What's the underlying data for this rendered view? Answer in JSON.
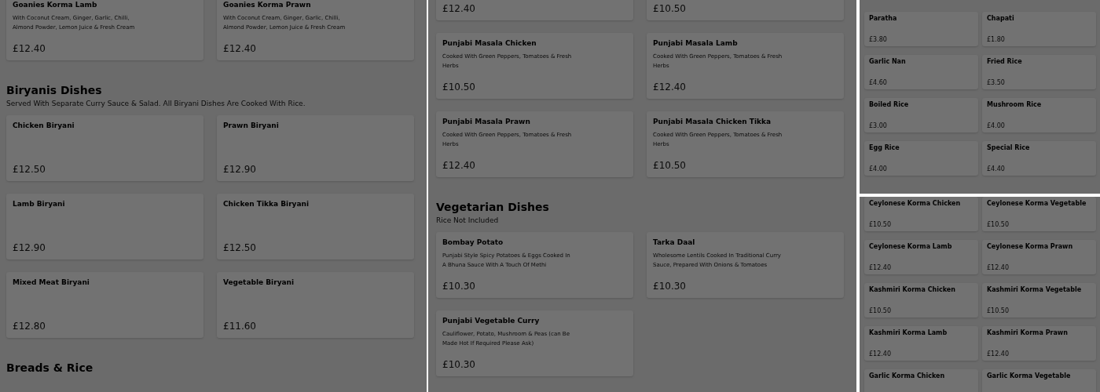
{
  "panels": [
    {
      "kind": "full",
      "sections": [
        {
          "items": [
            {
              "name": "Goanies Korma Lamb",
              "description": "With Coconut Cream, Ginger, Garlic, Chilli, Almond Powder, Lemon Juice & Fresh Cream",
              "price": "£12.40"
            },
            {
              "name": "Goanies Korma Prawn",
              "description": "With Coconut Cream, Ginger, Garlic, Chilli, Almond Powder, Lemon Juice & Fresh Cream",
              "price": "£12.40"
            }
          ]
        },
        {
          "heading": "Biryanis Dishes",
          "subtitle": "Served With Separate Curry Sauce & Salad. All Biryani Dishes Are Cooked With Rice.",
          "items": [
            {
              "name": "Chicken Biryani",
              "price": "£12.50"
            },
            {
              "name": "Prawn Biryani",
              "price": "£12.90"
            },
            {
              "name": "Lamb Biryani",
              "price": "£12.90"
            },
            {
              "name": "Chicken Tikka Biryani",
              "price": "£12.50"
            },
            {
              "name": "Mixed Meat Biryani",
              "price": "£12.80"
            },
            {
              "name": "Vegetable Biryani",
              "price": "£11.60"
            }
          ]
        },
        {
          "heading": "Breads & Rice"
        }
      ]
    },
    {
      "kind": "full",
      "sections": [
        {
          "items": [
            {
              "price": "£12.40"
            },
            {
              "price": "£10.50"
            },
            {
              "name": "Punjabi Masala Chicken",
              "description": "Cooked With Green Peppers, Tomatoes & Fresh Herbs",
              "price": "£10.50"
            },
            {
              "name": "Punjabi Masala Lamb",
              "description": "Cooked With Green Peppers, Tomatoes & Fresh Herbs",
              "price": "£12.40"
            },
            {
              "name": "Punjabi Masala Prawn",
              "description": "Cooked With Green Peppers, Tomatoes & Fresh Herbs",
              "price": "£12.40"
            },
            {
              "name": "Punjabi Masala Chicken Tikka",
              "description": "Cooked With Green Peppers, Tomatoes & Fresh Herbs",
              "price": "£10.50"
            }
          ]
        },
        {
          "heading": "Vegetarian Dishes",
          "subtitle": "Rice Not Included",
          "items": [
            {
              "name": "Bombay Potato",
              "description": "Punjabi Style Spicy Potatoes & Eggs Cooked In A Bhuna Sauce With A Touch Of Methi",
              "price": "£10.30"
            },
            {
              "name": "Tarka Daal",
              "description": "Wholesome Lentils Cooked In Traditional Curry Sauce, Prepared With Onions & Tomatoes",
              "price": "£10.30"
            },
            {
              "name": "Punjabi Vegetable Curry",
              "description": "Cauliflower, Potato, Mushroom & Peas (can Be Made Hot If Required Please Ask)",
              "price": "£10.30"
            }
          ]
        }
      ]
    },
    {
      "kind": "compact",
      "sections": [
        {
          "items": [
            {
              "name": "Paratha",
              "price": "£3.80"
            },
            {
              "name": "Chapati",
              "price": "£1.80"
            },
            {
              "name": "Garlic Nan",
              "price": "£4.60"
            },
            {
              "name": "Fried Rice",
              "price": "£3.50"
            },
            {
              "name": "Boiled Rice",
              "price": "£3.00"
            },
            {
              "name": "Mushroom Rice",
              "price": "£4.00"
            },
            {
              "name": "Egg Rice",
              "price": "£4.00"
            },
            {
              "name": "Special Rice",
              "price": "£4.40"
            }
          ]
        }
      ]
    },
    {
      "kind": "compact",
      "sections": [
        {
          "items": [
            {
              "name": "Ceylonese Korma Chicken",
              "price": "£10.50"
            },
            {
              "name": "Ceylonese Korma Vegetable",
              "price": "£10.50"
            },
            {
              "name": "Ceylonese Korma Lamb",
              "price": "£12.40"
            },
            {
              "name": "Ceylonese Korma Prawn",
              "price": "£12.40"
            },
            {
              "name": "Kashmiri Korma Chicken",
              "price": "£10.50"
            },
            {
              "name": "Kashmiri Korma Vegetable",
              "price": "£10.50"
            },
            {
              "name": "Kashmiri Korma Lamb",
              "price": "£12.40"
            },
            {
              "name": "Kashmiri Korma Prawn",
              "price": "£12.40"
            },
            {
              "name": "Garlic Korma Chicken"
            },
            {
              "name": "Garlic Korma Vegetable"
            }
          ]
        }
      ]
    }
  ]
}
